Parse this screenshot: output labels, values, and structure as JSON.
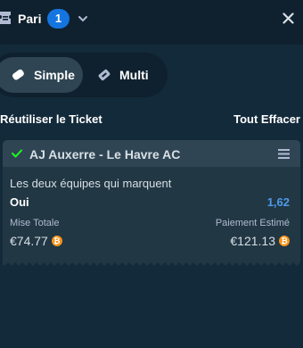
{
  "header": {
    "title": "Pari",
    "count": "1",
    "icons": {
      "ticket": "ticket-icon",
      "expand": "chevron-down-icon",
      "close": "close-icon"
    }
  },
  "tabs": [
    {
      "label": "Simple",
      "icon": "ticket-icon",
      "active": true
    },
    {
      "label": "Multi",
      "icon": "layers-icon",
      "active": false
    }
  ],
  "actions": {
    "reuse_label": "Réutiliser le Ticket",
    "clear_label": "Tout Effacer"
  },
  "bet": {
    "match": "AJ Auxerre - Le Havre AC",
    "market": "Les deux équipes qui marquent",
    "selection": "Oui",
    "odds": "1,62",
    "stake_label": "Mise Totale",
    "stake_value": "€74.77",
    "payout_label": "Paiement Estimé",
    "payout_value": "€121.13",
    "currency_symbol": "₿"
  },
  "colors": {
    "background": "#0f212e",
    "panel": "#132a3a",
    "card_header": "#2f4553",
    "card_body": "#213743",
    "accent_blue": "#1475e1",
    "odds": "#4f9be8",
    "check_green": "#1fff20",
    "coin": "#f7931a"
  }
}
